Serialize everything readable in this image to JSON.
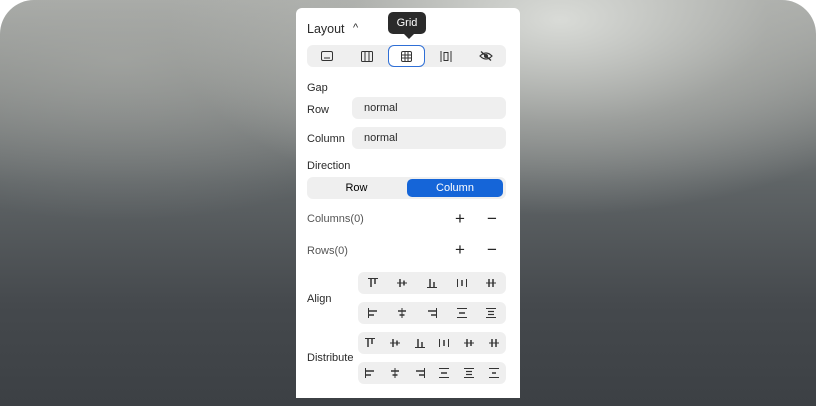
{
  "layout": {
    "title": "Layout",
    "collapse_glyph": "^",
    "tooltip": "Grid",
    "modes": [
      {
        "icon": "block-icon",
        "active": false
      },
      {
        "icon": "flex-icon",
        "active": false
      },
      {
        "icon": "grid-icon",
        "active": true
      },
      {
        "icon": "inline-icon",
        "active": false
      },
      {
        "icon": "hidden-eye-icon",
        "active": false
      }
    ]
  },
  "gap": {
    "title": "Gap",
    "row_label": "Row",
    "row_value": "normal",
    "column_label": "Column",
    "column_value": "normal"
  },
  "direction": {
    "title": "Direction",
    "options": [
      "Row",
      "Column"
    ],
    "selected": "Column"
  },
  "columns": {
    "label": "Columns(0)",
    "add": "+",
    "remove": "−"
  },
  "rows": {
    "label": "Rows(0)",
    "add": "+",
    "remove": "−"
  },
  "align": {
    "title": "Align"
  },
  "distribute": {
    "title": "Distribute"
  },
  "colors": {
    "accent": "#1565d8",
    "active_ring": "#2f6fd6",
    "control_bg": "#efefef"
  }
}
